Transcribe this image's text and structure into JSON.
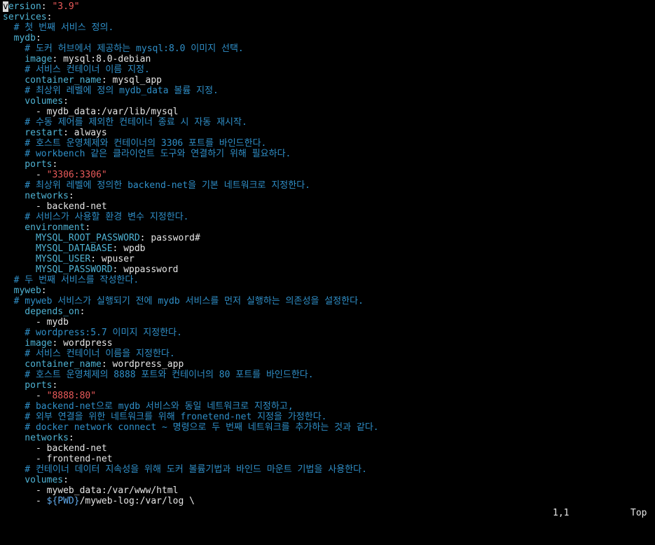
{
  "editor": {
    "lines": [
      [
        {
          "c": "cur",
          "t": "v"
        },
        {
          "c": "k",
          "t": "ersion"
        },
        {
          "c": "t",
          "t": ": "
        },
        {
          "c": "s",
          "t": "\"3.9\""
        }
      ],
      [
        {
          "c": "k",
          "t": "services"
        },
        {
          "c": "t",
          "t": ":"
        }
      ],
      [
        {
          "c": "c",
          "t": "  # 첫 번째 서비스 정의."
        }
      ],
      [
        {
          "c": "k",
          "t": "  mydb"
        },
        {
          "c": "t",
          "t": ":"
        }
      ],
      [
        {
          "c": "c",
          "t": "    # 도커 허브에서 제공하는 mysql:8.0 이미지 선택."
        }
      ],
      [
        {
          "c": "k",
          "t": "    image"
        },
        {
          "c": "t",
          "t": ": mysql:8.0-debian"
        }
      ],
      [
        {
          "c": "c",
          "t": "    # 서비스 컨테이너 이름 지정."
        }
      ],
      [
        {
          "c": "k",
          "t": "    container_name"
        },
        {
          "c": "t",
          "t": ": mysql_app"
        }
      ],
      [
        {
          "c": "c",
          "t": "    # 최상위 레벨에 정의 mydb_data 볼륨 지정."
        }
      ],
      [
        {
          "c": "k",
          "t": "    volumes"
        },
        {
          "c": "t",
          "t": ":"
        }
      ],
      [
        {
          "c": "t",
          "t": "      - mydb_data:/var/lib/mysql"
        }
      ],
      [
        {
          "c": "c",
          "t": "    # 수동 제어를 제외한 컨테이너 종료 시 자동 재시작."
        }
      ],
      [
        {
          "c": "k",
          "t": "    restart"
        },
        {
          "c": "t",
          "t": ": always"
        }
      ],
      [
        {
          "c": "c",
          "t": "    # 호스트 운영체제와 컨테이너의 3306 포트를 바인드한다."
        }
      ],
      [
        {
          "c": "c",
          "t": "    # workbench 같은 클라이언트 도구와 연결하기 위해 필요하다."
        }
      ],
      [
        {
          "c": "k",
          "t": "    ports"
        },
        {
          "c": "t",
          "t": ":"
        }
      ],
      [
        {
          "c": "t",
          "t": "      - "
        },
        {
          "c": "s",
          "t": "\"3306:3306\""
        }
      ],
      [
        {
          "c": "c",
          "t": "    # 최상위 레벨에 정의한 backend-net을 기본 네트워크로 지정한다."
        }
      ],
      [
        {
          "c": "k",
          "t": "    networks"
        },
        {
          "c": "t",
          "t": ":"
        }
      ],
      [
        {
          "c": "t",
          "t": "      - backend-net"
        }
      ],
      [
        {
          "c": "c",
          "t": "    # 서비스가 사용할 환경 변수 지정한다."
        }
      ],
      [
        {
          "c": "k",
          "t": "    environment"
        },
        {
          "c": "t",
          "t": ":"
        }
      ],
      [
        {
          "c": "k",
          "t": "      MYSQL_ROOT_PASSWORD"
        },
        {
          "c": "t",
          "t": ": password#"
        }
      ],
      [
        {
          "c": "k",
          "t": "      MYSQL_DATABASE"
        },
        {
          "c": "t",
          "t": ": wpdb"
        }
      ],
      [
        {
          "c": "k",
          "t": "      MYSQL_USER"
        },
        {
          "c": "t",
          "t": ": wpuser"
        }
      ],
      [
        {
          "c": "k",
          "t": "      MYSQL_PASSWORD"
        },
        {
          "c": "t",
          "t": ": wppassword"
        }
      ],
      [
        {
          "c": "c",
          "t": "  # 두 번째 서비스를 작성한다."
        }
      ],
      [
        {
          "c": "k",
          "t": "  myweb"
        },
        {
          "c": "t",
          "t": ":"
        }
      ],
      [
        {
          "c": "c",
          "t": "  # myweb 서비스가 실행되기 전에 mydb 서비스를 먼저 실행하는 의존성을 설정한다."
        }
      ],
      [
        {
          "c": "k",
          "t": "    depends_on"
        },
        {
          "c": "t",
          "t": ":"
        }
      ],
      [
        {
          "c": "t",
          "t": "      - mydb"
        }
      ],
      [
        {
          "c": "c",
          "t": "    # wordpress:5.7 이미지 지정한다."
        }
      ],
      [
        {
          "c": "k",
          "t": "    image"
        },
        {
          "c": "t",
          "t": ": wordpress"
        }
      ],
      [
        {
          "c": "c",
          "t": "    # 서비스 컨테이너 이름을 지정한다."
        }
      ],
      [
        {
          "c": "k",
          "t": "    container_name"
        },
        {
          "c": "t",
          "t": ": wordpress_app"
        }
      ],
      [
        {
          "c": "c",
          "t": "    # 호스트 운영체제의 8888 포트와 컨테이너의 80 포트를 바인드한다."
        }
      ],
      [
        {
          "c": "k",
          "t": "    ports"
        },
        {
          "c": "t",
          "t": ":"
        }
      ],
      [
        {
          "c": "t",
          "t": "      - "
        },
        {
          "c": "s",
          "t": "\"8888:80\""
        }
      ],
      [
        {
          "c": "c",
          "t": "    # backend-net으로 mydb 서비스와 동일 네트워크로 지정하고,"
        }
      ],
      [
        {
          "c": "c",
          "t": "    # 외부 연결을 위한 네트워크를 위해 fronetend-net 지정을 가정한다."
        }
      ],
      [
        {
          "c": "c",
          "t": "    # docker network connect ~ 명령으로 두 번째 네트워크를 추가하는 것과 같다."
        }
      ],
      [
        {
          "c": "k",
          "t": "    networks"
        },
        {
          "c": "t",
          "t": ":"
        }
      ],
      [
        {
          "c": "t",
          "t": "      - backend-net"
        }
      ],
      [
        {
          "c": "t",
          "t": "      - frontend-net"
        }
      ],
      [
        {
          "c": "c",
          "t": "    # 컨테이너 데이터 지속성을 위해 도커 볼륨기법과 바인드 마운트 기법을 사용한다."
        }
      ],
      [
        {
          "c": "k",
          "t": "    volumes"
        },
        {
          "c": "t",
          "t": ":"
        }
      ],
      [
        {
          "c": "t",
          "t": "      - myweb_data:/var/www/html"
        }
      ],
      [
        {
          "c": "t",
          "t": "      - "
        },
        {
          "c": "v",
          "t": "${PWD}"
        },
        {
          "c": "t",
          "t": "/myweb-log:/var/log \\"
        }
      ]
    ]
  },
  "statusbar": {
    "cursor_position": "1,1",
    "scroll_position": "Top"
  }
}
